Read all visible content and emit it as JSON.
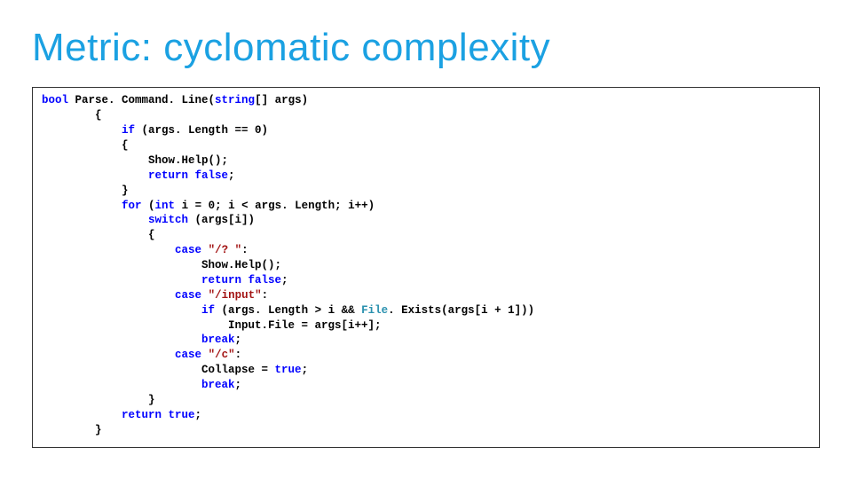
{
  "title": "Metric: cyclomatic complexity",
  "code": {
    "l1_kw_bool": "bool",
    "l1_fn": " Parse. Command. Line(",
    "l1_kw_string": "string",
    "l1_rest": "[] args)",
    "l2": "        {",
    "l3a": "            ",
    "l3_if": "if",
    "l3b": " (args. Length == 0)",
    "l4": "            {",
    "l5": "                Show.Help();",
    "l6a": "                ",
    "l6_ret": "return false",
    "l6b": ";",
    "l7": "            }",
    "l8a": "            ",
    "l8_for": "for",
    "l8b": " (",
    "l8_int": "int",
    "l8c": " i = 0; i < args. Length; i++)",
    "l9a": "                ",
    "l9_sw": "switch",
    "l9b": " (args[i])",
    "l10": "                {",
    "l11a": "                    ",
    "l11_case": "case",
    "l11b": " ",
    "l11_str": "\"/? \"",
    "l11c": ":",
    "l12": "                        Show.Help();",
    "l13a": "                        ",
    "l13_ret": "return false",
    "l13b": ";",
    "l14a": "                    ",
    "l14_case": "case",
    "l14b": " ",
    "l14_str": "\"/input\"",
    "l14c": ":",
    "l15a": "                        ",
    "l15_if": "if",
    "l15b": " (args. Length > i && ",
    "l15_file": "File",
    "l15c": ". Exists(args[i + 1]))",
    "l16": "                            Input.File = args[i++];",
    "l17a": "                        ",
    "l17_brk": "break",
    "l17b": ";",
    "l18a": "                    ",
    "l18_case": "case",
    "l18b": " ",
    "l18_str": "\"/c\"",
    "l18c": ":",
    "l19a": "                        Collapse = ",
    "l19_true": "true",
    "l19b": ";",
    "l20a": "                        ",
    "l20_brk": "break",
    "l20b": ";",
    "l21": "                }",
    "l22a": "            ",
    "l22_ret": "return true",
    "l22b": ";",
    "l23": "        }"
  }
}
